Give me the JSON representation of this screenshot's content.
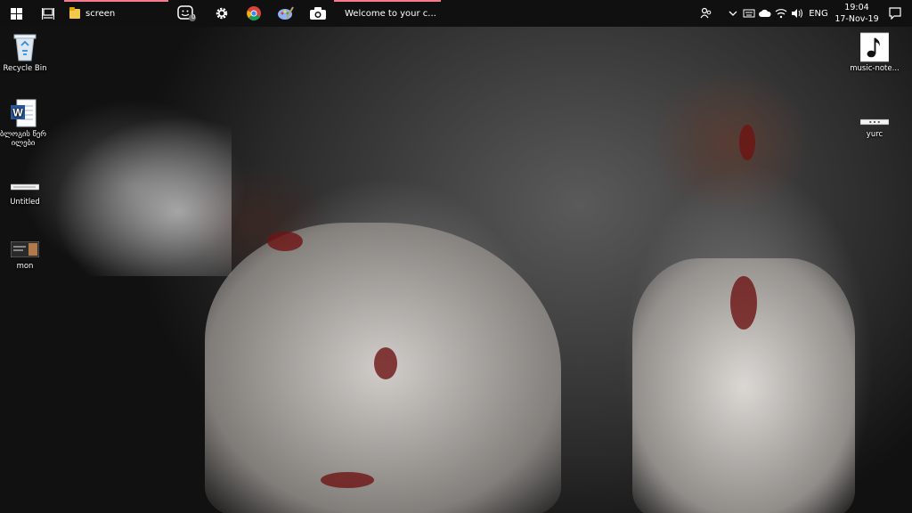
{
  "taskbar": {
    "apps": [
      {
        "name": "file-explorer",
        "label": "screen"
      },
      {
        "name": "chrome-window",
        "label": "Welcome to your c..."
      }
    ],
    "notification_badge": "0",
    "tray": {
      "language": "ENG",
      "time": "19:04",
      "date": "17-Nov-19"
    },
    "accent_color": "#f57c8c"
  },
  "desktop": {
    "icons_left": [
      {
        "label": "Recycle Bin",
        "icon": "recycle-bin-icon"
      },
      {
        "label": "ბლოგის წერილები",
        "icon": "word-document-icon"
      },
      {
        "label": "Untitled",
        "icon": "image-file-icon"
      },
      {
        "label": "mon",
        "icon": "image-file-icon"
      }
    ],
    "icons_right": [
      {
        "label": "music-note...",
        "icon": "music-note-icon"
      },
      {
        "label": "yurc",
        "icon": "image-file-icon"
      }
    ]
  }
}
